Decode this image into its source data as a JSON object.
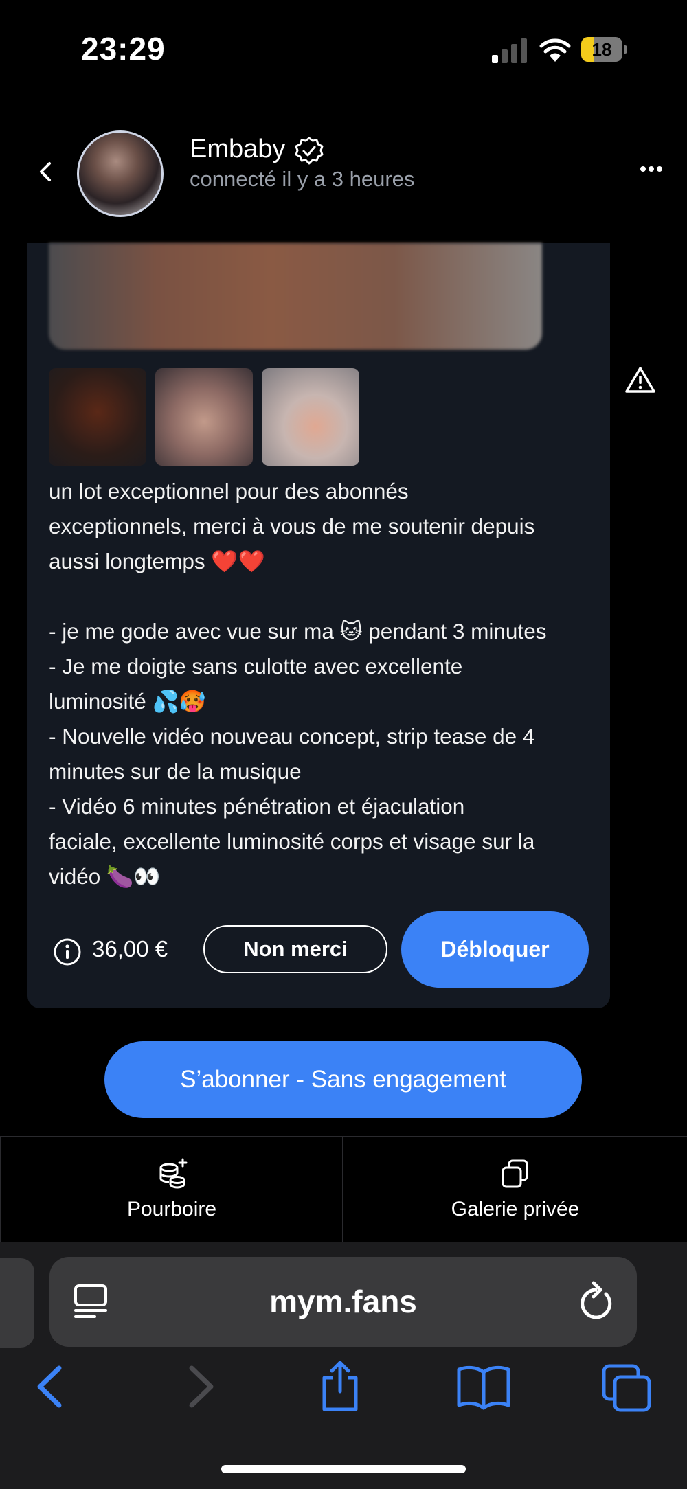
{
  "status_bar": {
    "time": "23:29",
    "battery": "18",
    "battery_fraction": 0.18
  },
  "header": {
    "name": "Embaby",
    "status": "connecté il y a 3 heures"
  },
  "message": {
    "text": "un lot exceptionnel pour des abonnés\nexceptionnels, merci à vous de me soutenir depuis\naussi longtemps ❤️❤️\n\n- je me gode avec vue sur ma 🐱 pendant 3 minutes\n- Je me doigte sans culotte avec excellente\nluminosité 💦🥵\n- Nouvelle vidéo nouveau concept, strip tease de 4\nminutes sur de la musique\n- Vidéo 6 minutes pénétration et éjaculation\nfaciale, excellente luminosité corps et visage sur la\nvidéo 🍆👀",
    "price": "36,00 €",
    "decline_label": "Non merci",
    "unlock_label": "Débloquer"
  },
  "subscribe_label": "S’abonner - Sans engagement",
  "tabs": [
    {
      "label": "Pourboire",
      "icon": "tip-coins-icon"
    },
    {
      "label": "Galerie privée",
      "icon": "gallery-icon"
    }
  ],
  "browser": {
    "url": "mym.fans"
  },
  "colors": {
    "accent": "#3b82f6",
    "card": "#141922",
    "battery": "#f4cc1b"
  }
}
